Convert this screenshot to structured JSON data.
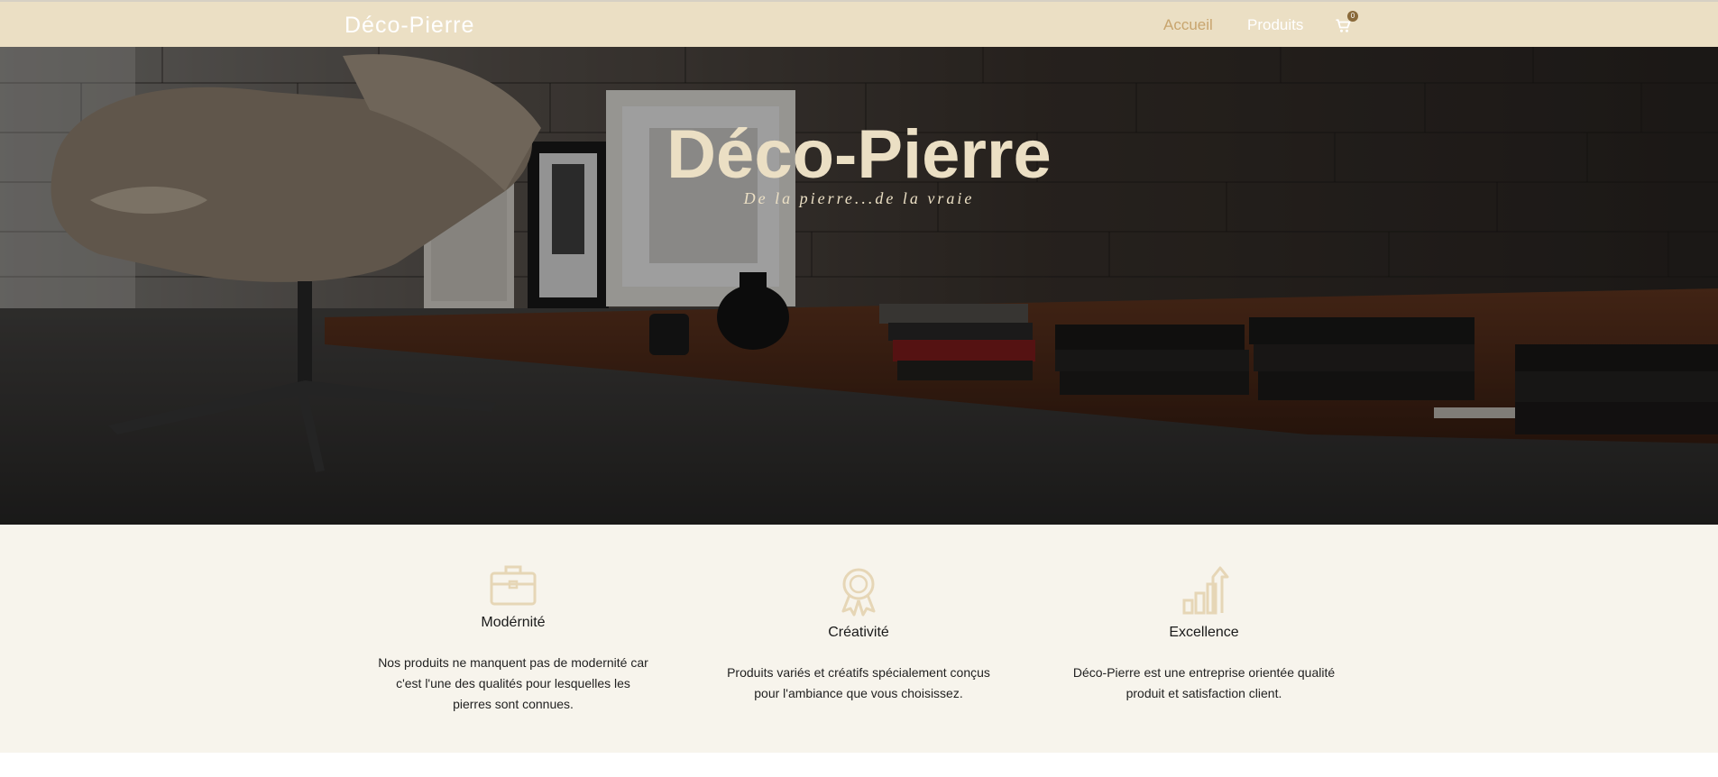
{
  "navbar": {
    "brand": "Déco-Pierre",
    "links": [
      {
        "label": "Accueil",
        "active": true
      },
      {
        "label": "Produits",
        "active": false
      }
    ],
    "cart": {
      "icon": "cart-icon",
      "count": "0"
    }
  },
  "hero": {
    "title": "Déco-Pierre",
    "subtitle": "De la pierre...de la vraie"
  },
  "features": [
    {
      "icon": "briefcase-icon",
      "title": "Modérnité",
      "text": "Nos produits ne manquent pas de modernité car c'est l'une des qualités pour lesquelles les pierres sont connues."
    },
    {
      "icon": "award-ribbon-icon",
      "title": "Créativité",
      "text": "Produits variés et créatifs spécialement conçus pour l'ambiance que vous choisissez."
    },
    {
      "icon": "growth-chart-arrow-icon",
      "title": "Excellence",
      "text": "Déco-Pierre est une entreprise orientée qualité produit et satisfaction client."
    }
  ],
  "colors": {
    "nav_bg": "#ebdfc4",
    "accent": "#c8a56e",
    "features_bg": "#f7f4ec"
  }
}
